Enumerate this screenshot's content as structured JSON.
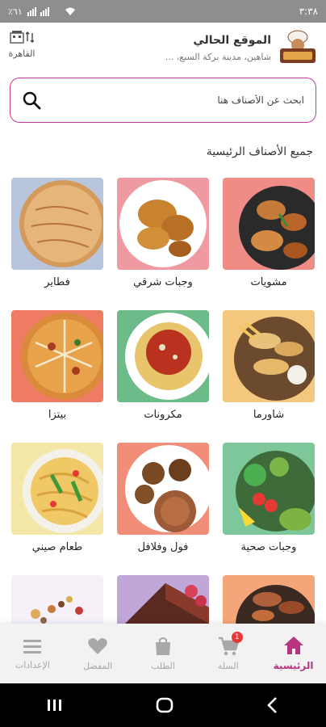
{
  "status_bar": {
    "time": "٣:٣٨",
    "battery": "٪٦١"
  },
  "header": {
    "location_title": "الموقع الحالي",
    "location_address": "شاهين، مدينة بركة السبع، ...",
    "city": "القاهرة",
    "logo": "chef-logo"
  },
  "search": {
    "placeholder": "ابحث عن الأصناف هنا"
  },
  "section_title": "جميع الأصناف الرئيسية",
  "categories": [
    {
      "label": "مشويات",
      "bg": "#ef8c86"
    },
    {
      "label": "وجبات شرقي",
      "bg": "#ef9aa0"
    },
    {
      "label": "فطاير",
      "bg": "#b9c4dd"
    },
    {
      "label": "شاورما",
      "bg": "#f4c77e"
    },
    {
      "label": "مكرونات",
      "bg": "#6ebb8a"
    },
    {
      "label": "بيتزا",
      "bg": "#ef7b63"
    },
    {
      "label": "وجبات صحية",
      "bg": "#7dc79a"
    },
    {
      "label": "فول وفلافل",
      "bg": "#f08e7a"
    },
    {
      "label": "طعام صيني",
      "bg": "#f3e6a7"
    },
    {
      "label": "",
      "bg": "#f4a67a"
    },
    {
      "label": "",
      "bg": "#c0a6d9"
    },
    {
      "label": "",
      "bg": "#f6f1f8"
    }
  ],
  "bottom_nav": {
    "home": "الرئيسية",
    "cart": "السلة",
    "cart_count": "1",
    "orders": "الطلب",
    "favorites": "المفضل",
    "settings": "الإعدادات"
  },
  "colors": {
    "accent": "#b8357f",
    "search_border": "#c63a9a",
    "badge": "#e53935"
  }
}
